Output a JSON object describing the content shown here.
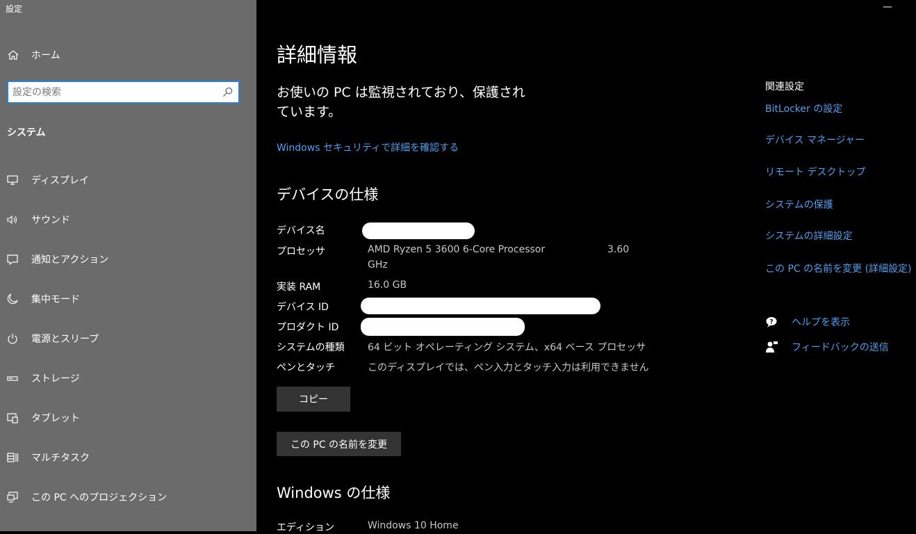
{
  "app": {
    "title": "設定",
    "minimize": "—"
  },
  "sidebar": {
    "home_label": "ホーム",
    "search_placeholder": "設定の検索",
    "section_label": "システム",
    "items": [
      {
        "label": "ディスプレイ",
        "icon": "display-icon"
      },
      {
        "label": "サウンド",
        "icon": "speaker-icon"
      },
      {
        "label": "通知とアクション",
        "icon": "notification-icon"
      },
      {
        "label": "集中モード",
        "icon": "moon-icon"
      },
      {
        "label": "電源とスリープ",
        "icon": "power-icon"
      },
      {
        "label": "ストレージ",
        "icon": "storage-icon"
      },
      {
        "label": "タブレット",
        "icon": "tablet-icon"
      },
      {
        "label": "マルチタスク",
        "icon": "multitask-icon"
      },
      {
        "label": "この PC へのプロジェクション",
        "icon": "projection-icon"
      }
    ]
  },
  "main": {
    "title": "詳細情報",
    "status_line1": "お使いの PC は監視されており、保護され",
    "status_line2": "ています。",
    "security_link": "Windows セキュリティで詳細を確認する",
    "device_spec_title": "デバイスの仕様",
    "specs": {
      "device_name_label": "デバイス名",
      "processor_label": "プロセッサ",
      "processor_value": "AMD Ryzen 5 3600 6-Core Processor",
      "processor_speed": "3.60",
      "processor_unit": "GHz",
      "ram_label": "実装 RAM",
      "ram_value": "16.0 GB",
      "device_id_label": "デバイス ID",
      "product_id_label": "プロダクト ID",
      "system_type_label": "システムの種類",
      "system_type_value": "64 ビット オペレーティング システム、x64 ベース プロセッサ",
      "pen_touch_label": "ペンとタッチ",
      "pen_touch_value": "このディスプレイでは、ペン入力とタッチ入力は利用できません"
    },
    "copy_button": "コピー",
    "rename_button": "この PC の名前を変更",
    "windows_spec_title": "Windows の仕様",
    "edition_label": "エディション",
    "edition_value": "Windows 10 Home"
  },
  "related": {
    "title": "関連設定",
    "links": [
      "BitLocker の設定",
      "デバイス マネージャー",
      "リモート デスクトップ",
      "システムの保護",
      "システムの詳細設定",
      "この PC の名前を変更 (詳細設定)"
    ],
    "help_label": "ヘルプを表示",
    "feedback_label": "フィードバックの送信"
  }
}
